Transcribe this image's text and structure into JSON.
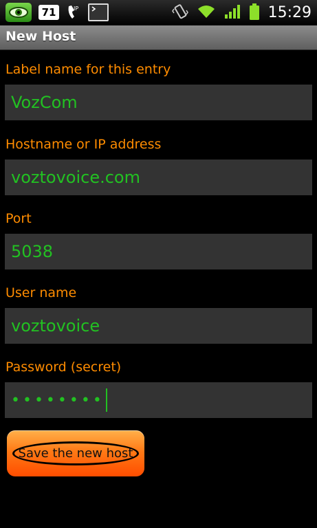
{
  "status_bar": {
    "notification_count": "71",
    "sip_label": "IP",
    "time": "15:29",
    "icons": [
      "eye-app-icon",
      "sip-phone-icon",
      "terminal-icon",
      "vibrate-icon",
      "wifi-icon",
      "signal-icon",
      "battery-icon"
    ]
  },
  "title_bar": {
    "title": "New Host"
  },
  "form": {
    "label_name": {
      "label": "Label name for this entry",
      "value": "VozCom"
    },
    "hostname": {
      "label": "Hostname or IP address",
      "value": "voztovoice.com"
    },
    "port": {
      "label": "Port",
      "value": "5038"
    },
    "username": {
      "label": "User name",
      "value": "voztovoice"
    },
    "password": {
      "label": "Password (secret)",
      "value": "••••••••"
    }
  },
  "save_button": {
    "label": "Save the new host"
  },
  "colors": {
    "label": "#ff8c00",
    "field_text": "#22c122",
    "field_bg": "#333333",
    "button": "#ff7a16"
  }
}
